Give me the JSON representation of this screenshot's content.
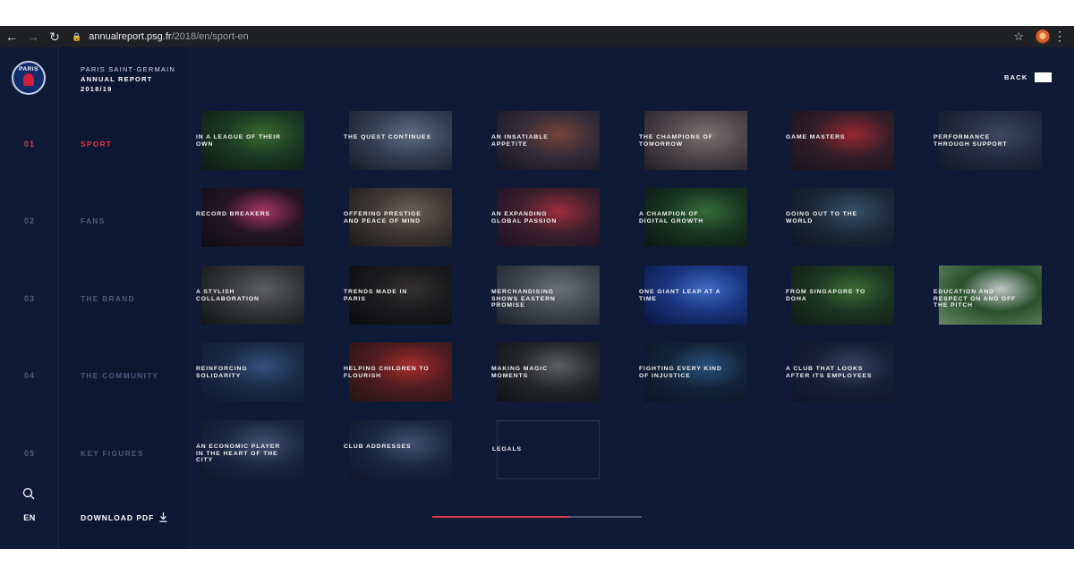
{
  "browser": {
    "back_icon": "arrow-left-icon",
    "forward_icon": "arrow-right-icon",
    "reload_icon": "reload-icon",
    "url_domain": "annualreport.psg.fr",
    "url_path": "/2018/en/sport-en"
  },
  "header": {
    "club": "PARIS SAINT-GERMAIN",
    "report": "ANNUAL REPORT",
    "season": "2018/19",
    "back_label": "BACK"
  },
  "logo": {
    "text": "PARIS"
  },
  "rail": {
    "numbers": [
      "01",
      "02",
      "03",
      "04",
      "05"
    ],
    "lang": "EN"
  },
  "menu": {
    "items": [
      "SPORT",
      "FANS",
      "THE BRAND",
      "THE COMMUNITY",
      "KEY FIGURES"
    ],
    "active_index": 0,
    "download": "DOWNLOAD PDF"
  },
  "tiles": [
    [
      "In a league of their own",
      "The quest continues",
      "An insatiable appetite",
      "The champions of tomorrow",
      "Game masters",
      "Performance through support"
    ],
    [
      "Record breakers",
      "Offering prestige and peace of mind",
      "An expanding global passion",
      "A champion of digital growth",
      "Going out to the world"
    ],
    [
      "A stylish collaboration",
      "Trends made in Paris",
      "Merchandising shows eastern promise",
      "One giant leap at a time",
      "From Singapore to Doha",
      "Education and respect on and off the pitch"
    ],
    [
      "Reinforcing solidarity",
      "Helping children to flourish",
      "Making magic moments",
      "Fighting every kind of injustice",
      "A club that looks after its employees"
    ],
    [
      "An economic player in the heart of the city",
      "Club addresses",
      "Legals"
    ]
  ],
  "progress": {
    "value": 0.66
  },
  "colors": {
    "background": "#0e1a36",
    "accent": "#e0354e",
    "muted": "#4a5a7e"
  }
}
